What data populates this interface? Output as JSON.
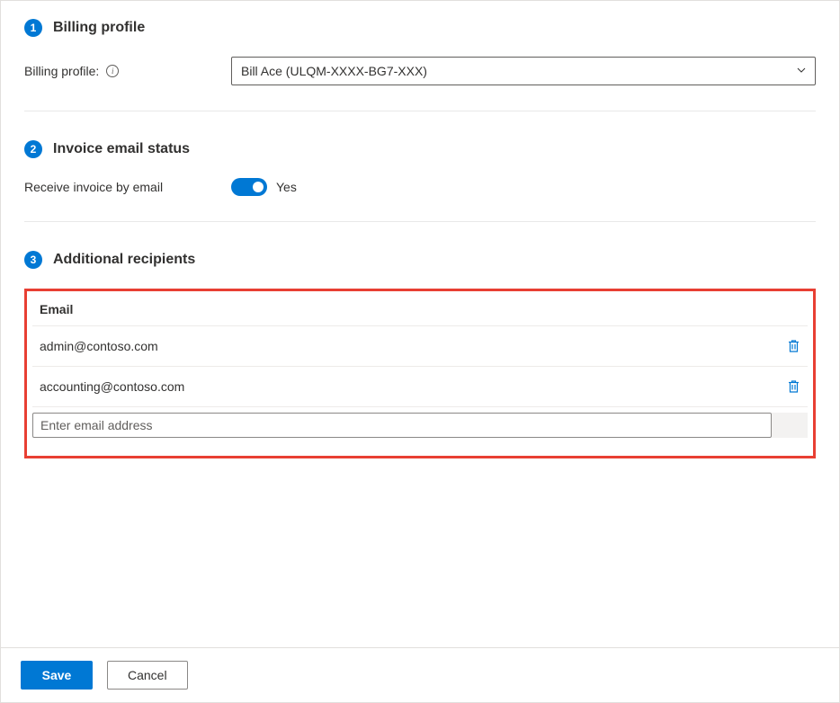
{
  "section1": {
    "step": "1",
    "title": "Billing profile",
    "fieldLabel": "Billing profile:",
    "selectedValue": "Bill Ace (ULQM-XXXX-BG7-XXX)"
  },
  "section2": {
    "step": "2",
    "title": "Invoice email status",
    "fieldLabel": "Receive invoice by email",
    "toggleState": "Yes"
  },
  "section3": {
    "step": "3",
    "title": "Additional recipients",
    "columnHeader": "Email",
    "emails": [
      "admin@contoso.com",
      "accounting@contoso.com"
    ],
    "inputPlaceholder": "Enter email address"
  },
  "footer": {
    "save": "Save",
    "cancel": "Cancel"
  }
}
